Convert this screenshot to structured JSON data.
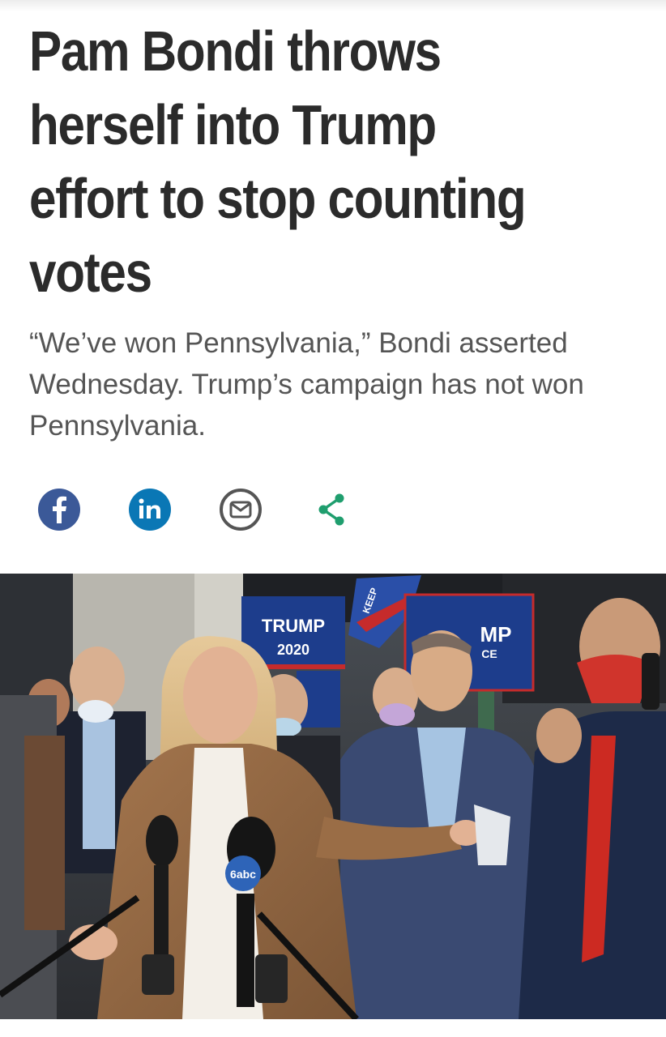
{
  "article": {
    "headline": "Pam Bondi throws herself into Trump effort to stop counting votes",
    "dek": "“We’ve won Pennsylvania,” Bondi asserted Wednesday. Trump’s campaign has not won Pennsylvania."
  },
  "share": {
    "buttons": [
      {
        "icon": "facebook-icon",
        "color": "#3b5998"
      },
      {
        "icon": "linkedin-icon",
        "color": "#0a77b5"
      },
      {
        "icon": "email-icon",
        "color": "#555555"
      },
      {
        "icon": "share-icon",
        "color": "#1f9e6e"
      }
    ]
  },
  "hero_image": {
    "signs": {
      "left_sign_line1": "TRUMP",
      "left_sign_line2": "2020",
      "right_sign_line1": "MP",
      "right_sign_line2": "CE",
      "flag_text": "KEEP"
    },
    "mic_logo": "6abc"
  }
}
